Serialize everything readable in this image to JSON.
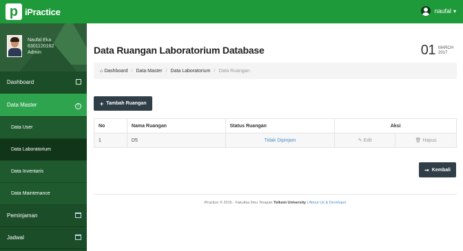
{
  "app": {
    "brand_logo_letter": "p",
    "brand_name": "iPractice"
  },
  "user_menu": {
    "username": "naufal",
    "caret": "▾"
  },
  "profile": {
    "name": "Naufal Eka",
    "id": "6301120162",
    "role": "Admin"
  },
  "sidebar": {
    "items": [
      {
        "label": "Dashboard"
      },
      {
        "label": "Data Master"
      }
    ],
    "sub_items": [
      {
        "label": "Data User"
      },
      {
        "label": "Data Laboratorium"
      },
      {
        "label": "Data Inventaris"
      },
      {
        "label": "Data Maintenance"
      }
    ],
    "bottom_items": [
      {
        "label": "Peminjaman"
      },
      {
        "label": "Jadwal"
      }
    ]
  },
  "page": {
    "title": "Data Ruangan Laboratorium Database",
    "date_day": "01",
    "date_month": "MARCH",
    "date_year": "2017"
  },
  "breadcrumb": {
    "items": [
      "Dashboard",
      "Data Master",
      "Data Laboratorium",
      "Data Ruangan"
    ],
    "separator": "/"
  },
  "toolbar": {
    "add_label": "Tambah Ruangan",
    "add_glyph": "+"
  },
  "table": {
    "headers": [
      "No",
      "Nama Ruangan",
      "Status Ruangan",
      "Aksi"
    ],
    "rows": [
      {
        "no": "1",
        "nama": "D5",
        "status": "Tidak Dipinjam",
        "edit": "Edit",
        "hapus": "Hapus"
      }
    ]
  },
  "back_button": {
    "label": "Kembali"
  },
  "footer": {
    "prefix": "iPractice © 2015 - Fakultas Ilmu Terapan",
    "university": "Telkom University",
    "separator": "|",
    "links": "About Us & Developer"
  },
  "colors": {
    "topbar": "#1f9a3a",
    "sidebar": "#1b4d28",
    "active_nav": "#2ea44f",
    "dark_button": "#2f3e47",
    "link": "#4a8fc8"
  }
}
